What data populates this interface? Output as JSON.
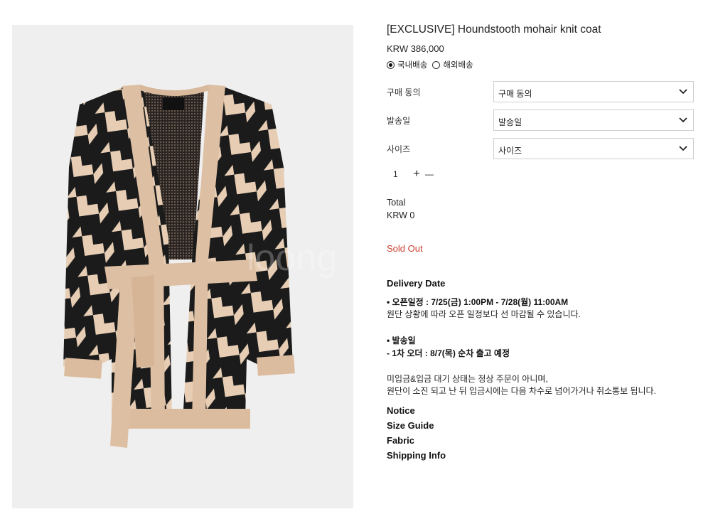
{
  "product": {
    "title": "[EXCLUSIVE] Houndstooth mohair knit coat",
    "price": "KRW 386,000",
    "image_alt": "houndstooth mohair knit cardigan coat with belt"
  },
  "shipping": {
    "options": [
      {
        "label": "국내배송",
        "selected": true
      },
      {
        "label": "해외배송",
        "selected": false
      }
    ]
  },
  "options": [
    {
      "label": "구매 동의",
      "value": "구매 동의"
    },
    {
      "label": "발송일",
      "value": "발송일"
    },
    {
      "label": "사이즈",
      "value": "사이즈"
    }
  ],
  "quantity": {
    "value": "1",
    "plus": "+",
    "minus": "—"
  },
  "total": {
    "label": "Total",
    "value": "KRW 0"
  },
  "status": {
    "sold_out": "Sold Out"
  },
  "delivery": {
    "title": "Delivery Date",
    "line1": "• 오픈일정 : 7/25(금) 1:00PM - 7/28(월) 11:00AM",
    "line2": "원단 상황에 따라 오픈 일정보다 선 마감될 수 있습니다.",
    "line3": "• 발송일",
    "line4": "- 1차 오더 : 8/7(목) 순차 출고 예정",
    "line5": "미입금&입금 대기 상태는 정상 주문이 아니며,",
    "line6": "원단이 소진 되고 난 뒤 입금시에는 다음 차수로 넘어가거나 취소통보 됩니다."
  },
  "links": [
    "Notice",
    "Size Guide",
    "Fabric",
    "Shipping Info"
  ],
  "colors": {
    "sold_out": "#c9402d",
    "image_bg": "#efefef",
    "coat_cream": "#e8cfb7",
    "coat_black": "#1b1b1b"
  }
}
